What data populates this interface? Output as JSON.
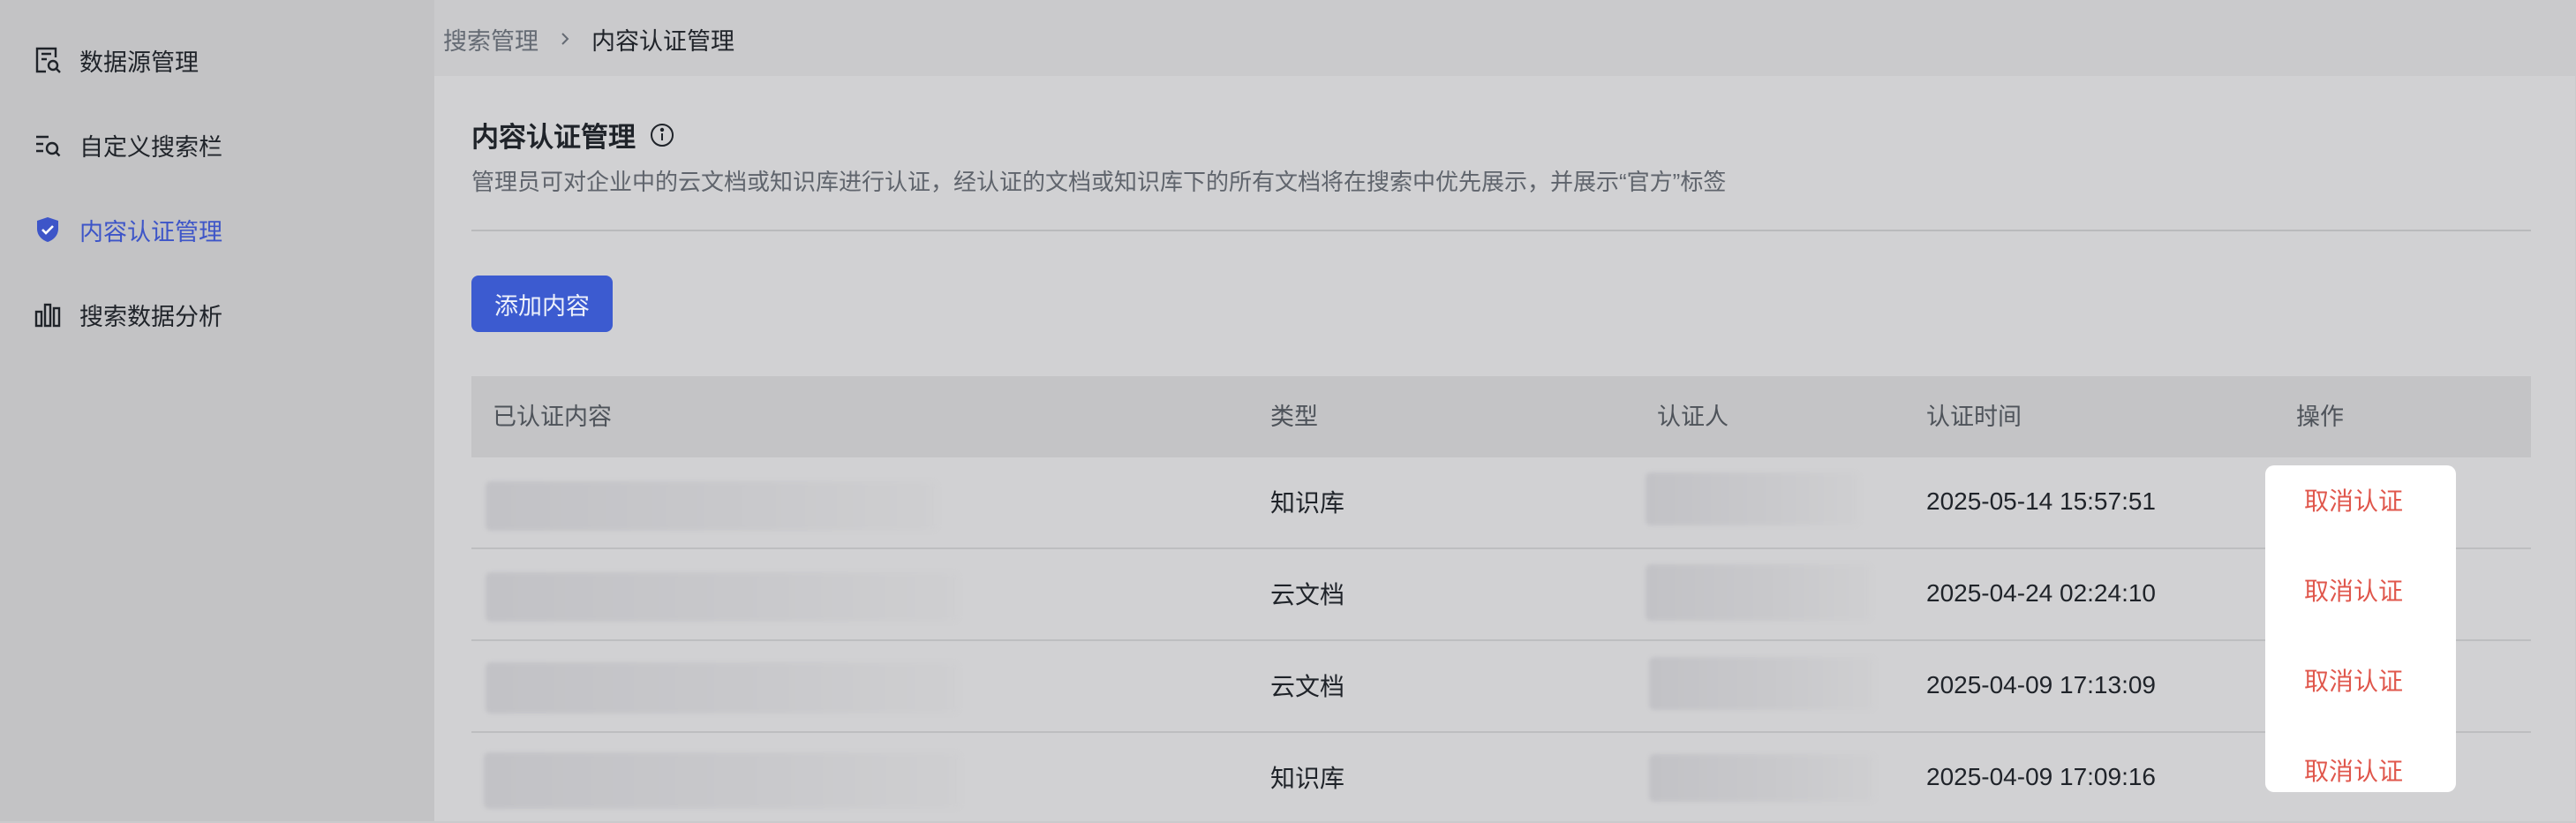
{
  "sidebar": {
    "items": [
      {
        "label": "数据源管理",
        "icon": "data-source-icon",
        "active": false
      },
      {
        "label": "自定义搜索栏",
        "icon": "search-list-icon",
        "active": false
      },
      {
        "label": "内容认证管理",
        "icon": "shield-check-icon",
        "active": true
      },
      {
        "label": "搜索数据分析",
        "icon": "bar-chart-icon",
        "active": false
      }
    ]
  },
  "breadcrumb": {
    "parent": "搜索管理",
    "current": "内容认证管理"
  },
  "page": {
    "title": "内容认证管理",
    "description": "管理员可对企业中的云文档或知识库进行认证，经认证的文档或知识库下的所有文档将在搜索中优先展示，并展示“官方”标签",
    "add_button": "添加内容"
  },
  "table": {
    "headers": [
      "已认证内容",
      "类型",
      "认证人",
      "认证时间",
      "操作"
    ],
    "rows": [
      {
        "type": "知识库",
        "time": "2025-05-14 15:57:51",
        "action": "取消认证"
      },
      {
        "type": "云文档",
        "time": "2025-04-24 02:24:10",
        "action": "取消认证"
      },
      {
        "type": "云文档",
        "time": "2025-04-09 17:13:09",
        "action": "取消认证"
      },
      {
        "type": "知识库",
        "time": "2025-04-09 17:09:16",
        "action": "取消认证"
      }
    ]
  },
  "colors": {
    "accent": "#3c5bd0",
    "danger": "#e0574c",
    "active_nav": "#3d55c8"
  }
}
